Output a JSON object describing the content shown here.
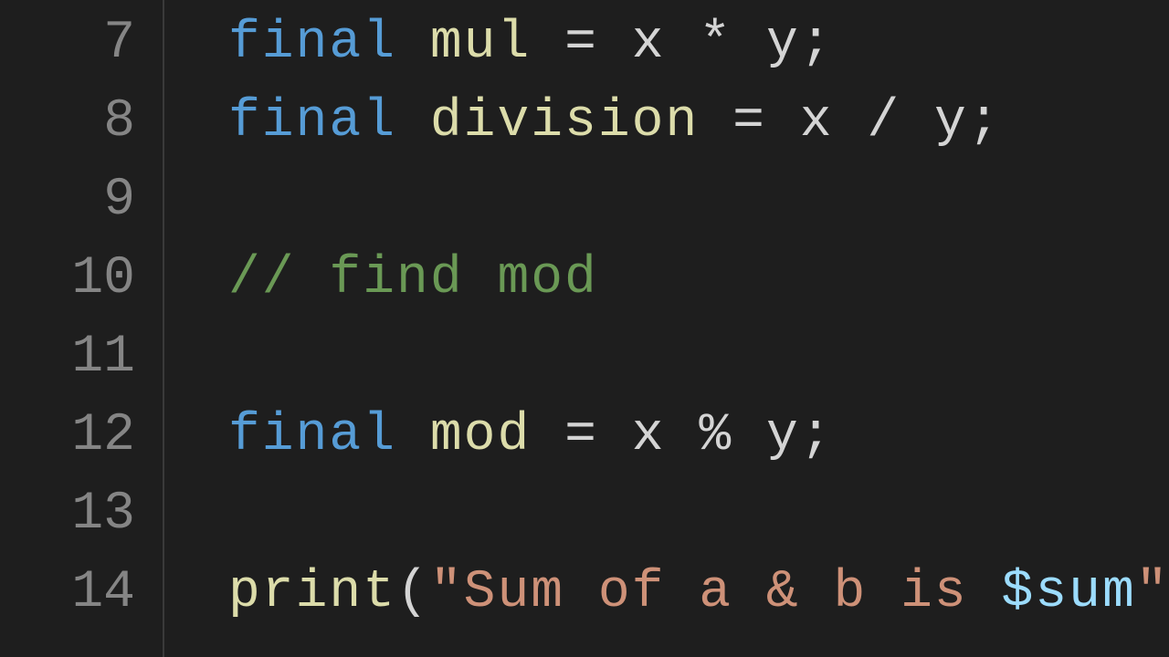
{
  "gutter": {
    "l7": "7",
    "l8": "8",
    "l9": "9",
    "l10": "10",
    "l11": "11",
    "l12": "12",
    "l13": "13",
    "l14": "14"
  },
  "code": {
    "l7": {
      "kw": "final",
      "sp1": " ",
      "name": "mul",
      "sp2": " ",
      "eq": "=",
      "sp3": " ",
      "lhs": "x",
      "sp4": " ",
      "op": "*",
      "sp5": " ",
      "rhs": "y",
      "semi": ";"
    },
    "l8": {
      "kw": "final",
      "sp1": " ",
      "name": "division",
      "sp2": " ",
      "eq": "=",
      "sp3": " ",
      "lhs": "x",
      "sp4": " ",
      "op": "/",
      "sp5": " ",
      "rhs": "y",
      "semi": ";"
    },
    "l10": {
      "comment": "// find mod"
    },
    "l12": {
      "kw": "final",
      "sp1": " ",
      "name": "mod",
      "sp2": " ",
      "eq": "=",
      "sp3": " ",
      "lhs": "x",
      "sp4": " ",
      "op": "%",
      "sp5": " ",
      "rhs": "y",
      "semi": ";"
    },
    "l14": {
      "func": "print",
      "lp": "(",
      "q1": "\"",
      "str": "Sum of a & b is ",
      "interp": "$sum",
      "q2": "\"",
      "rp": ")",
      "semi": ";"
    }
  }
}
